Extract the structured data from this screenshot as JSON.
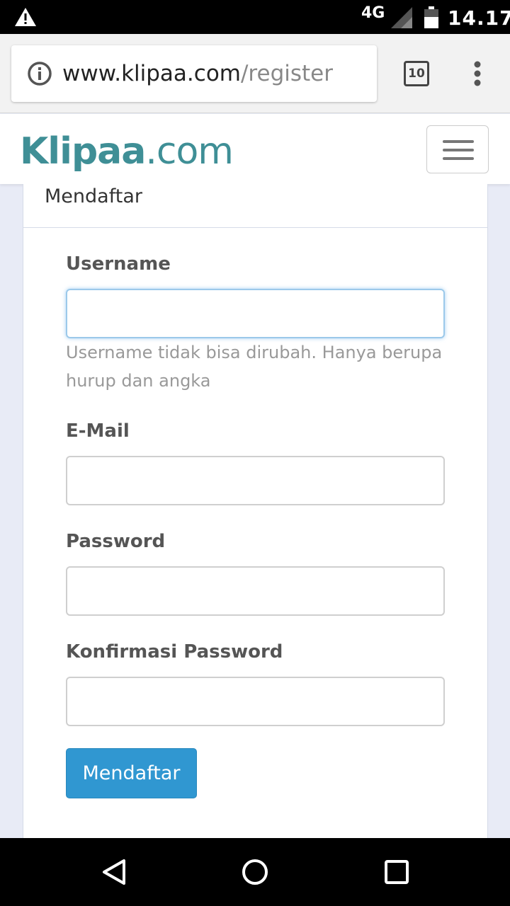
{
  "status_bar": {
    "network": "4G",
    "time": "14.17",
    "icons": [
      "warning-icon",
      "signal-icon",
      "battery-icon"
    ]
  },
  "browser": {
    "url_host": "www.klipaa.com",
    "url_path": "/register",
    "tab_count": "10",
    "icons": [
      "info-icon",
      "menu-dots-icon"
    ]
  },
  "site": {
    "logo_primary": "Klipaa",
    "logo_suffix": ".com",
    "brand_color": "#3f8f96",
    "icons": [
      "hamburger-menu-icon"
    ]
  },
  "form": {
    "heading": "Mendaftar",
    "fields": [
      {
        "label": "Username",
        "value": "",
        "help": "Username tidak bisa dirubah. Hanya berupa hurup dan angka"
      },
      {
        "label": "E-Mail",
        "value": ""
      },
      {
        "label": "Password",
        "value": ""
      },
      {
        "label": "Konfirmasi Password",
        "value": ""
      }
    ],
    "submit_label": "Mendaftar",
    "accent_color": "#3097d1"
  },
  "nav_bar": {
    "icons": [
      "back-icon",
      "home-icon",
      "recents-icon"
    ]
  }
}
